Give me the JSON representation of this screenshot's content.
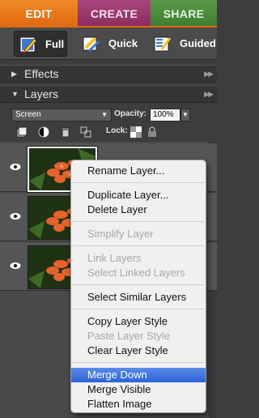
{
  "tabs": {
    "edit": "EDIT",
    "create": "CREATE",
    "share": "SHARE"
  },
  "modes": {
    "full": "Full",
    "quick": "Quick",
    "guided": "Guided"
  },
  "panels": {
    "effects": "Effects",
    "layers": "Layers"
  },
  "layer_options": {
    "blend_mode": "Screen",
    "opacity_label": "Opacity:",
    "opacity_value": "100%",
    "lock_label": "Lock:"
  },
  "colors": {
    "accent_edit": "#e06a10",
    "create": "#8c2c60",
    "share": "#3f7e30",
    "menu_highlight": "#2c62d8"
  },
  "context_menu": {
    "rename": "Rename Layer...",
    "duplicate": "Duplicate Layer...",
    "delete": "Delete Layer",
    "simplify": "Simplify Layer",
    "link": "Link Layers",
    "select_linked": "Select Linked Layers",
    "select_similar": "Select Similar Layers",
    "copy_style": "Copy Layer Style",
    "paste_style": "Paste Layer Style",
    "clear_style": "Clear Layer Style",
    "merge_down": "Merge Down",
    "merge_visible": "Merge Visible",
    "flatten": "Flatten Image"
  }
}
